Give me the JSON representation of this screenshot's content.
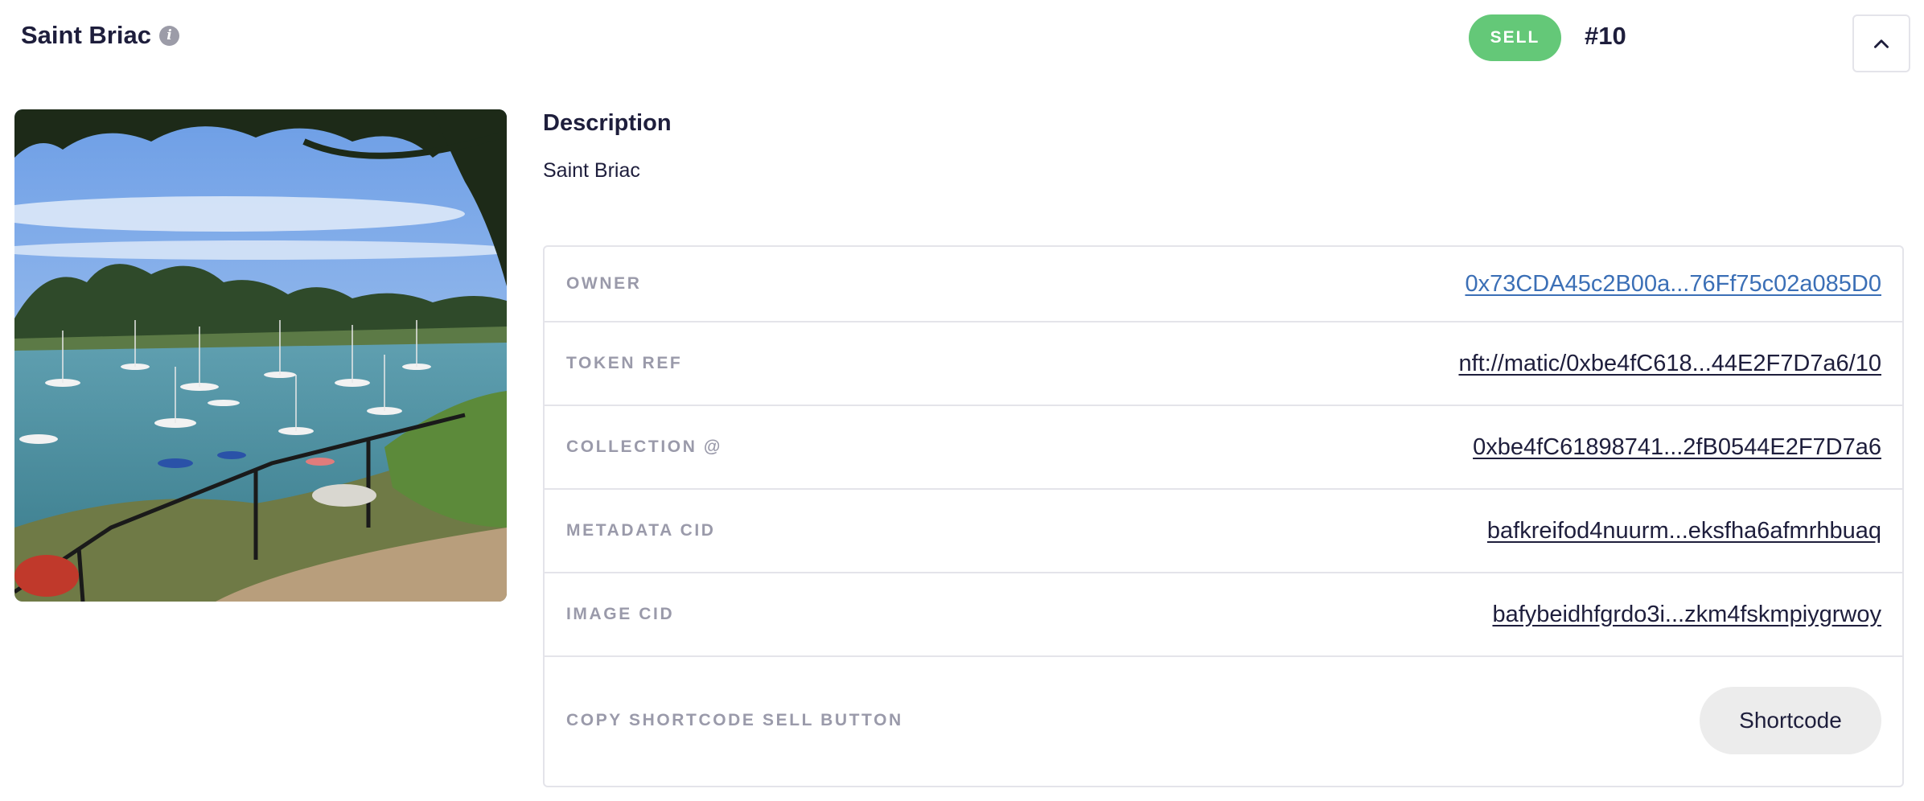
{
  "header": {
    "title": "Saint Briac",
    "info_icon": "info-icon",
    "badge": "SELL",
    "token_number": "#10",
    "collapse_icon": "chevron-up-icon"
  },
  "image": {
    "alt": "Saint Briac",
    "subject": "harbour with sailboats, pine branches and railing"
  },
  "description": {
    "heading": "Description",
    "text": "Saint Briac"
  },
  "properties": [
    {
      "label": "OWNER",
      "value": "0x73CDA45c2B00a...76Ff75c02a085D0"
    },
    {
      "label": "TOKEN REF",
      "value": "nft://matic/0xbe4fC618...44E2F7D7a6/10"
    },
    {
      "label": "COLLECTION @",
      "value": "0xbe4fC61898741...2fB0544E2F7D7a6"
    },
    {
      "label": "METADATA CID",
      "value": "bafkreifod4nuurm...eksfha6afmrhbuaq"
    },
    {
      "label": "IMAGE CID",
      "value": "bafybeidhfgrdo3i...zkm4fskmpiygrwoy"
    }
  ],
  "shortcode": {
    "label": "COPY SHORTCODE SELL BUTTON",
    "button": "Shortcode"
  },
  "colors": {
    "badge": "#64c878",
    "owner_link": "#3b6fb6",
    "text": "#1e1e3c",
    "label": "#9a9aaa",
    "border": "#e4e4ea"
  }
}
